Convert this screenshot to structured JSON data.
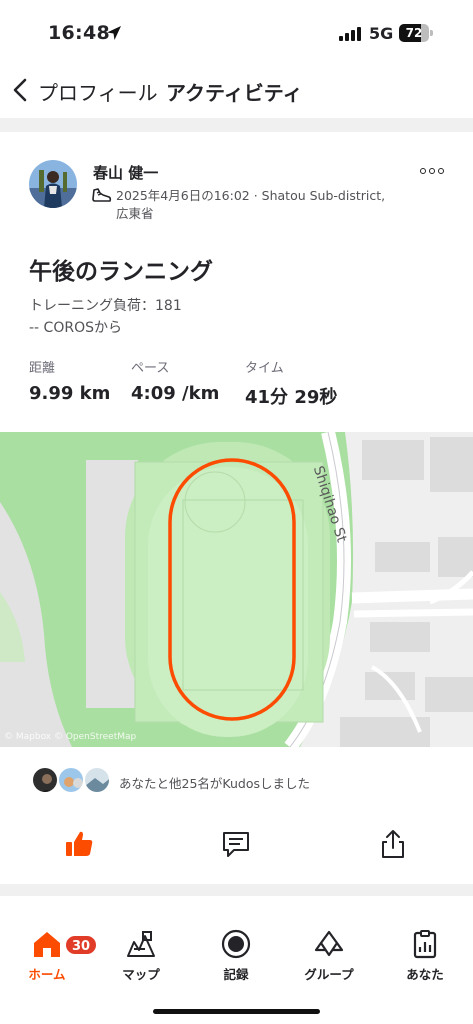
{
  "status_bar": {
    "time": "16:48",
    "network": "5G",
    "battery": "72",
    "battery_level": 0.72
  },
  "header": {
    "parent_label": "プロフィール",
    "title": "アクティビティ"
  },
  "activity": {
    "athlete_name": "春山 健一",
    "meta": "2025年4月6日の16:02 · Shatou Sub-district, 広東省",
    "title": "午後のランニング",
    "description_lines": [
      "トレーニング負荷：181",
      "-- COROSから"
    ],
    "stats": [
      {
        "label": "距離",
        "value": "9.99 km"
      },
      {
        "label": "ペース",
        "value": "4:09 /km"
      },
      {
        "label": "タイム",
        "value": "41分 29秒"
      }
    ]
  },
  "map": {
    "street_label": "Shiqihao St",
    "attribution": "© Mapbox © OpenStreetMap",
    "route_color": "#fc4c02"
  },
  "kudos": {
    "text": "あなたと他25名がKudosしました"
  },
  "actions": {
    "kudos_icon": "thumbs-up-icon",
    "comment_icon": "comment-icon",
    "share_icon": "share-icon"
  },
  "tabs": [
    {
      "label": "ホーム",
      "icon": "home-icon",
      "badge": "30",
      "active": true
    },
    {
      "label": "マップ",
      "icon": "map-icon",
      "active": false
    },
    {
      "label": "記録",
      "icon": "record-icon",
      "active": false
    },
    {
      "label": "グループ",
      "icon": "groups-icon",
      "active": false
    },
    {
      "label": "あなた",
      "icon": "you-icon",
      "active": false
    }
  ],
  "colors": {
    "brand": "#fc4c02",
    "badge": "#e03c28",
    "map_green": "#bfe8b5"
  }
}
